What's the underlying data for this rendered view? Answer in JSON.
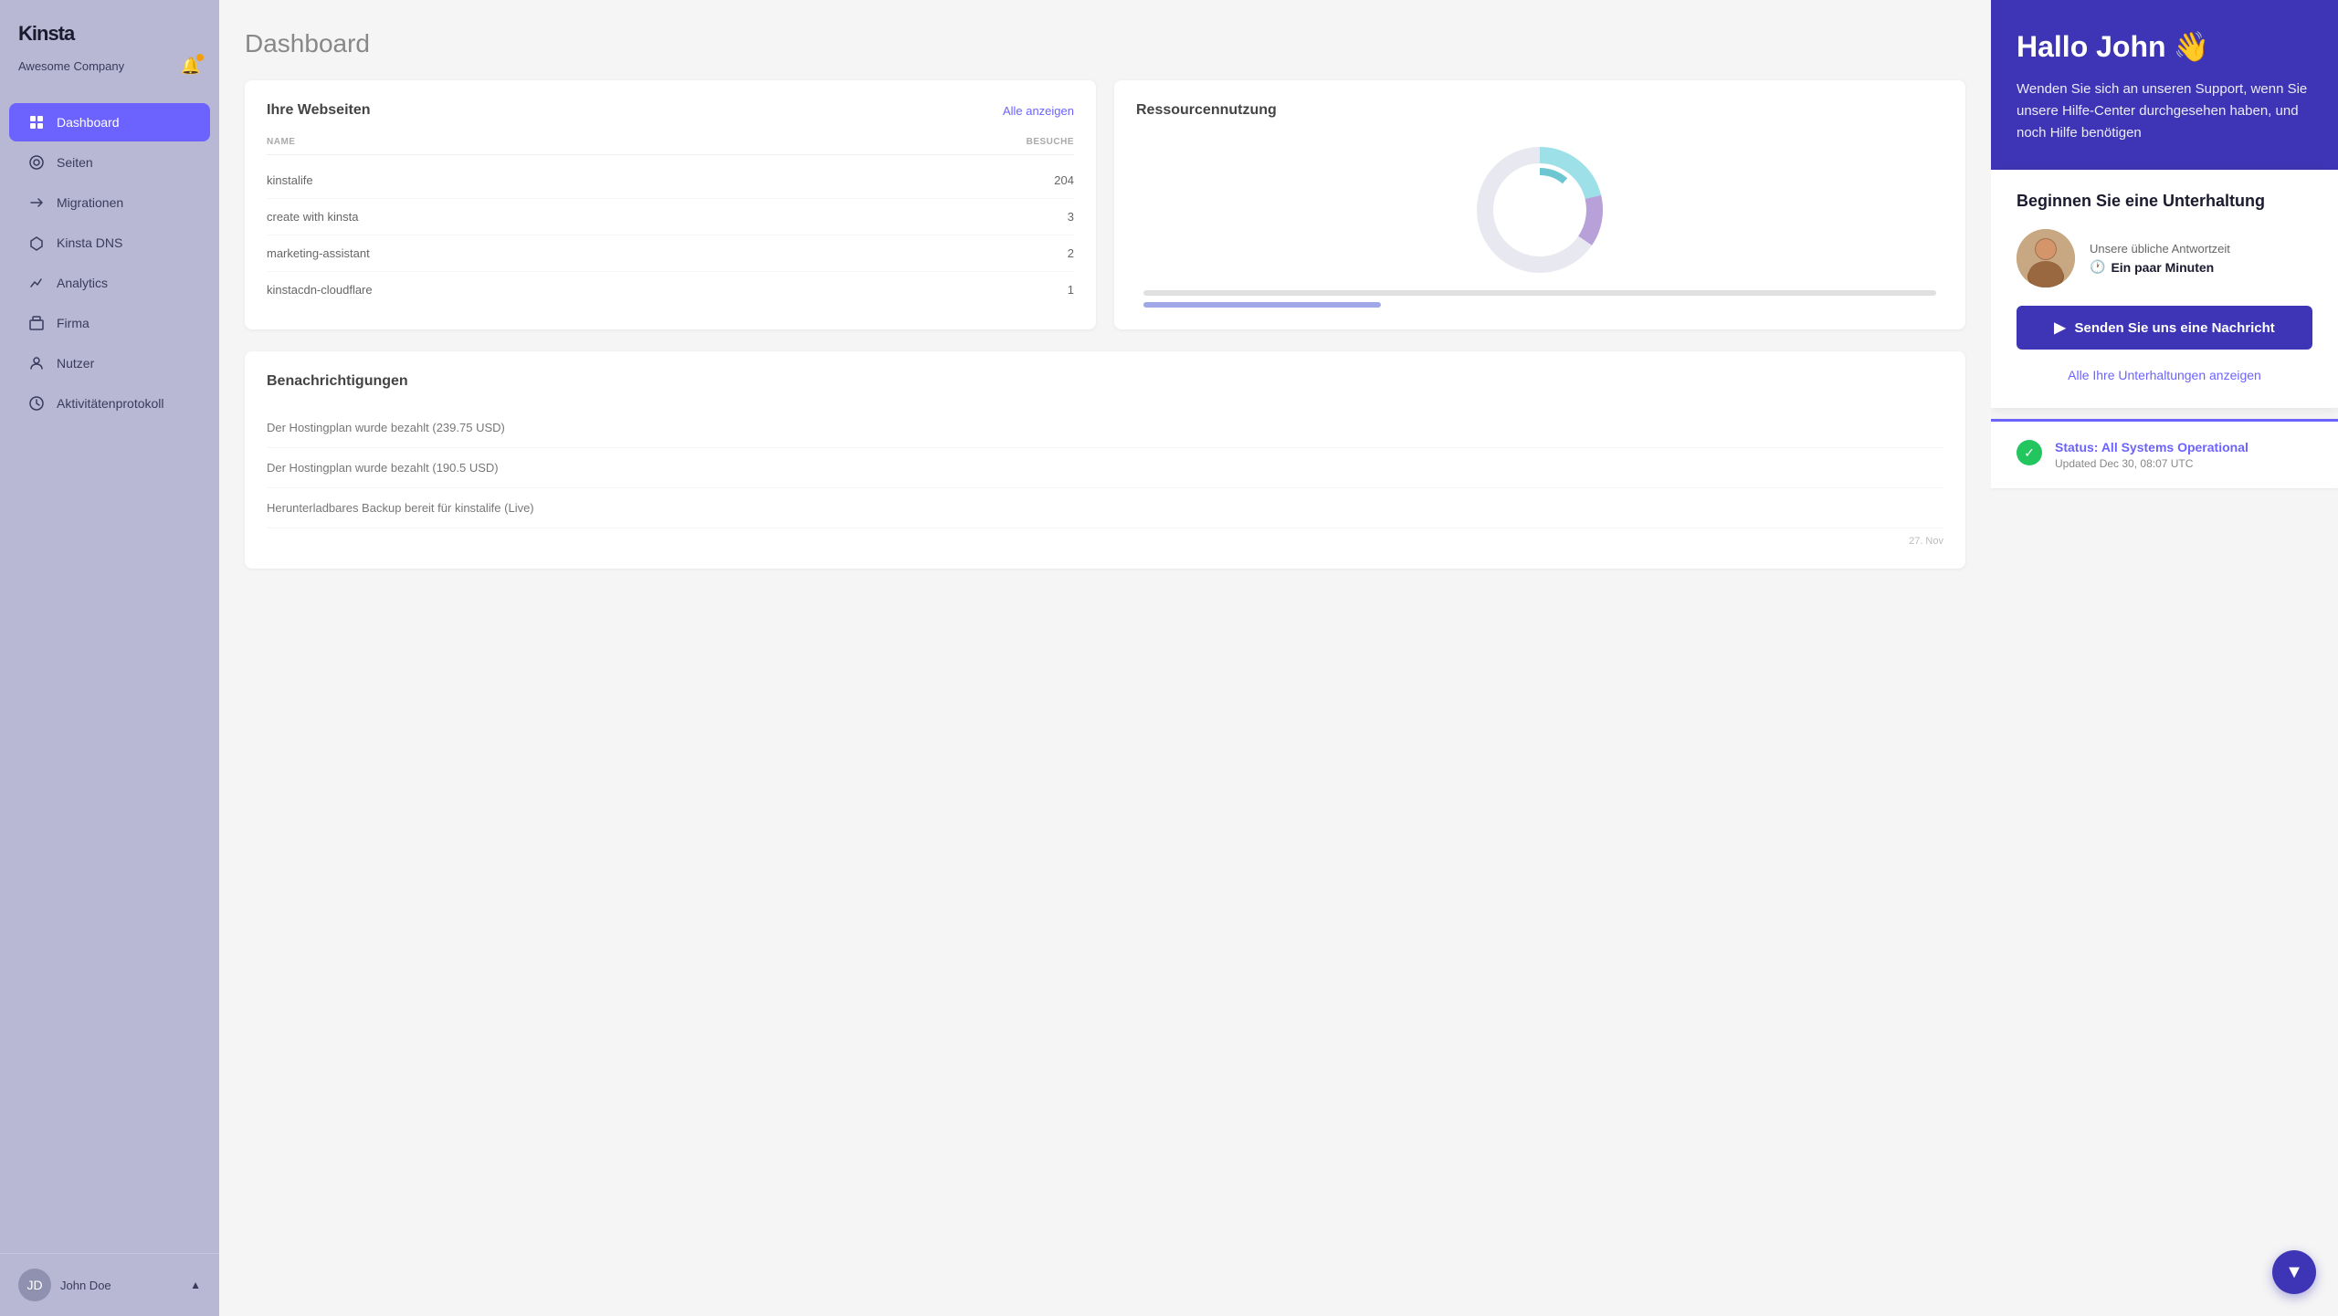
{
  "sidebar": {
    "logo": "Kinsta",
    "company": "Awesome Company",
    "nav": [
      {
        "id": "dashboard",
        "label": "Dashboard",
        "icon": "⊙",
        "active": true
      },
      {
        "id": "seiten",
        "label": "Seiten",
        "icon": "◎",
        "active": false
      },
      {
        "id": "migrationen",
        "label": "Migrationen",
        "icon": "↗",
        "active": false
      },
      {
        "id": "kinsta-dns",
        "label": "Kinsta DNS",
        "icon": "⇄",
        "active": false
      },
      {
        "id": "analytics",
        "label": "Analytics",
        "icon": "↗",
        "active": false
      },
      {
        "id": "firma",
        "label": "Firma",
        "icon": "▦",
        "active": false
      },
      {
        "id": "nutzer",
        "label": "Nutzer",
        "icon": "👤",
        "active": false
      },
      {
        "id": "aktivitaeten",
        "label": "Aktivitätenprotokoll",
        "icon": "◑",
        "active": false
      }
    ],
    "user": {
      "name": "John Doe",
      "initials": "JD"
    }
  },
  "main": {
    "title": "Dashboard",
    "websites_card": {
      "heading": "Ihre Webseiten",
      "link": "Alle anzeigen",
      "columns": [
        "NAME",
        "BESUCHE"
      ],
      "rows": [
        {
          "name": "kinstalife",
          "visits": "204"
        },
        {
          "name": "create with kinsta",
          "visits": "3"
        },
        {
          "name": "marketing-assistant",
          "visits": "2"
        },
        {
          "name": "kinstacdn-cloudflare",
          "visits": "1"
        }
      ]
    },
    "resource_card": {
      "heading": "Ressourcennutzung"
    },
    "notifications": {
      "heading": "Benachrichtigungen",
      "items": [
        {
          "text": "Der Hostingplan wurde bezahlt (239.75 USD)",
          "date": ""
        },
        {
          "text": "Der Hostingplan wurde bezahlt (190.5 USD)",
          "date": ""
        },
        {
          "text": "Herunterladbares Backup bereit für kinstalife (Live)",
          "date": ""
        }
      ],
      "dates": [
        "27. Nov",
        "27."
      ]
    }
  },
  "support_panel": {
    "greeting": "Hallo John",
    "wave": "👋",
    "description": "Wenden Sie sich an unseren Support, wenn Sie unsere Hilfe-Center durchgesehen haben, und noch Hilfe benötigen",
    "chat_title": "Beginnen Sie eine Unterhaltung",
    "response_label": "Unsere übliche Antwortzeit",
    "response_time": "Ein paar Minuten",
    "send_button": "Senden Sie uns eine Nachricht",
    "all_conversations": "Alle Ihre Unterhaltungen anzeigen",
    "status": {
      "label": "Status: All Systems Operational",
      "updated": "Updated Dec 30, 08:07 UTC"
    }
  },
  "colors": {
    "primary": "#3d35b5",
    "accent": "#6c63ff",
    "success": "#22c55e",
    "sidebar_bg": "#b8b8d4"
  }
}
